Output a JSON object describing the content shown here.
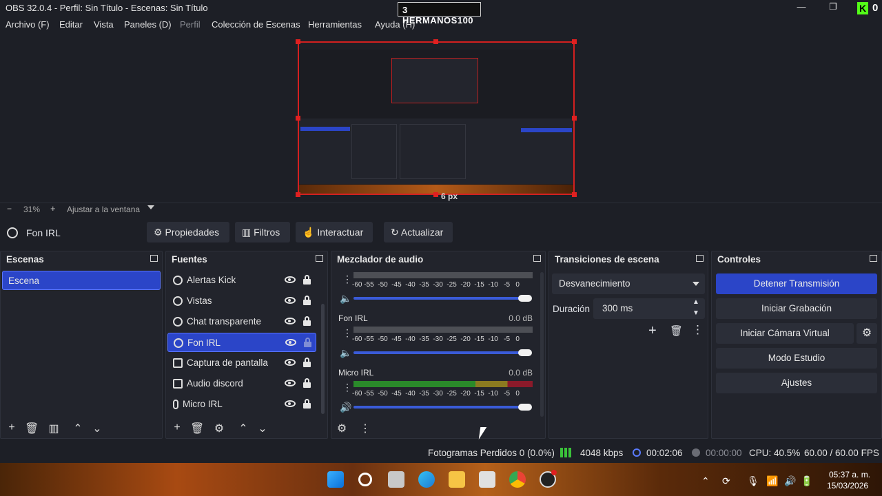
{
  "window": {
    "title": "OBS 32.0.4 - Perfil: Sin Título - Escenas: Sin Título",
    "badge": "3   HERMANOS100",
    "kick_count": "0"
  },
  "menu": [
    "Archivo (F)",
    "Editar",
    "Vista",
    "Paneles (D)",
    "Perfil",
    "Colección de Escenas",
    "Herramientas",
    "Ayuda (H)"
  ],
  "preview": {
    "size_label": "6 px"
  },
  "zoom": {
    "minus": "−",
    "value": "31%",
    "plus": "+",
    "fit_label": "Ajustar a la ventana"
  },
  "source_toolbar": {
    "source_name": "Fon IRL",
    "properties": "Propiedades",
    "filters": "Filtros",
    "interact": "Interactuar",
    "refresh": "Actualizar"
  },
  "scenes": {
    "title": "Escenas",
    "items": [
      "Escena"
    ]
  },
  "sources": {
    "title": "Fuentes",
    "items": [
      "Alertas Kick",
      "Vistas",
      "Chat transparente",
      "Fon IRL",
      "Captura de pantalla",
      "Audio discord",
      "Micro IRL"
    ]
  },
  "mixer": {
    "title": "Mezclador de audio",
    "ticks": [
      "-60",
      "-55",
      "-50",
      "-45",
      "-40",
      "-35",
      "-30",
      "-25",
      "-20",
      "-15",
      "-10",
      "-5",
      "0"
    ],
    "channels": [
      {
        "name": "Fon IRL",
        "db": "0.0 dB"
      },
      {
        "name": "Micro IRL",
        "db": "0.0 dB"
      }
    ]
  },
  "transitions": {
    "title": "Transiciones de escena",
    "selected": "Desvanecimiento",
    "duration_label": "Duración",
    "duration_value": "300 ms"
  },
  "controls": {
    "title": "Controles",
    "stop_stream": "Detener Transmisión",
    "start_record": "Iniciar Grabación",
    "virtual_cam": "Iniciar Cámara Virtual",
    "studio_mode": "Modo Estudio",
    "settings": "Ajustes"
  },
  "status": {
    "dropped": "Fotogramas Perdidos 0 (0.0%)",
    "bitrate": "4048 kbps",
    "stream_time": "00:02:06",
    "record_time": "00:00:00",
    "cpu": "CPU: 40.5%",
    "fps": "60.00 / 60.00 FPS"
  },
  "taskbar": {
    "time": "05:37 a. m.",
    "date": "15/03/2026"
  },
  "colors": {
    "accent": "#2b45c8",
    "selection_border": "#d42020",
    "kick": "#53fc18"
  }
}
